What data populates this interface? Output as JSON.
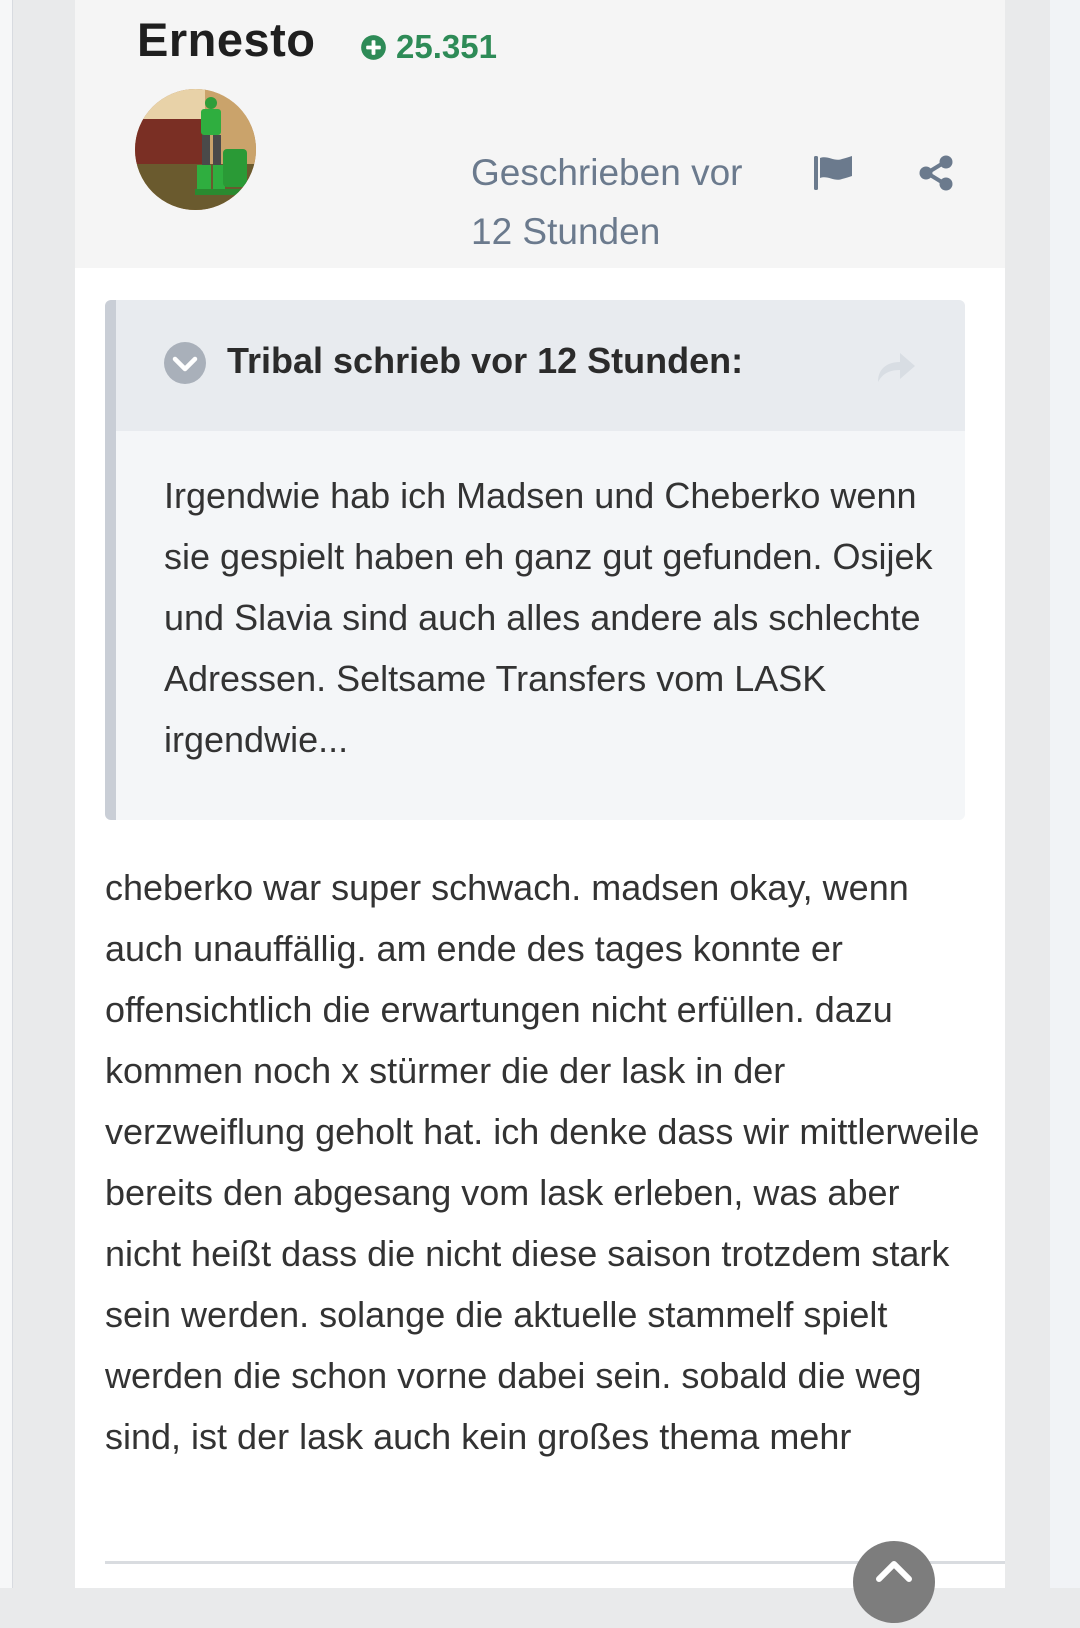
{
  "author": {
    "name": "Ernesto",
    "reputation": "25.351"
  },
  "meta": {
    "posted_line1": "Geschrieben vor",
    "posted_line2": "12 Stunden"
  },
  "quote": {
    "citation": "Tribal schrieb vor 12 Stunden:",
    "text": "Irgendwie hab ich Madsen und Cheberko wenn sie gespielt haben eh ganz gut gefunden. Osijek und Slavia sind auch alles andere als schlechte Adressen. Seltsame Transfers vom LASK irgendwie..."
  },
  "post": {
    "text": "cheberko war super schwach. madsen okay, wenn auch unauffällig. am ende des tages konnte er offensichtlich die erwartungen nicht erfüllen. dazu kommen noch x stürmer die der lask in der verzweiflung geholt hat. ich denke dass wir mittlerweile bereits den abgesang vom lask erleben, was aber nicht heißt dass die nicht diese saison trotzdem stark sein werden. solange die aktuelle stammelf spielt werden die schon vorne dabei sein. sobald die weg sind, ist der lask auch kein großes thema mehr"
  },
  "icons": {
    "reputation": "plus-circle-icon",
    "report": "flag-icon",
    "share": "share-icon",
    "quote_toggle": "chevron-down-icon",
    "quote_link": "arrow-forward-icon",
    "scroll": "chevron-up-icon"
  },
  "colors": {
    "reputation": "#2e8b57",
    "meta_text": "#6b7a8d",
    "quote_border": "#c9ced6"
  }
}
